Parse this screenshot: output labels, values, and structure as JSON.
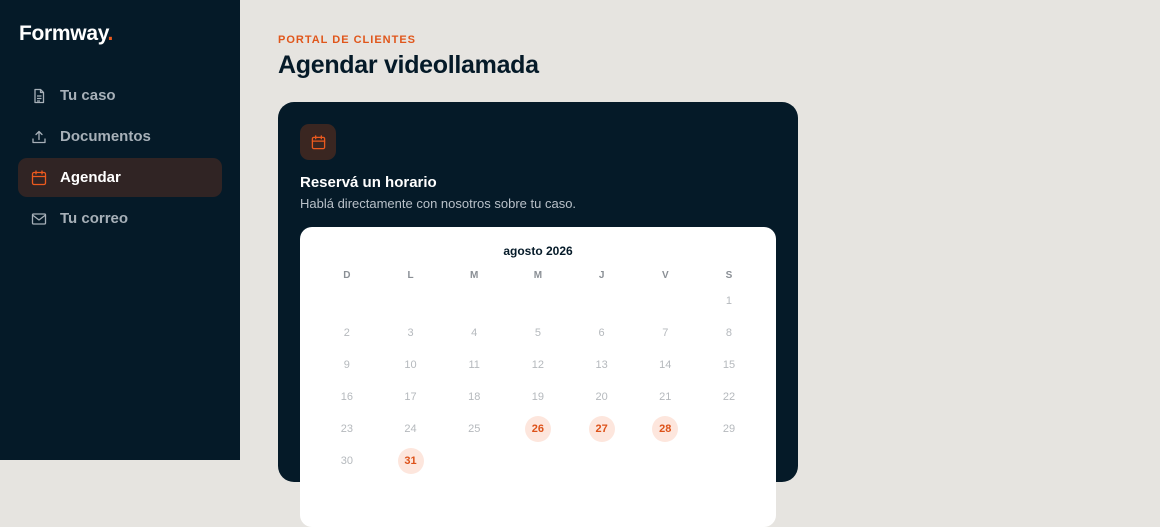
{
  "brand": {
    "name": "Formway",
    "dot": "."
  },
  "sidebar": {
    "items": [
      {
        "label": "Tu caso",
        "icon": "file-icon",
        "active": false
      },
      {
        "label": "Documentos",
        "icon": "upload-icon",
        "active": false
      },
      {
        "label": "Agendar",
        "icon": "calendar-icon",
        "active": true
      },
      {
        "label": "Tu correo",
        "icon": "mail-icon",
        "active": false
      }
    ]
  },
  "header": {
    "eyebrow": "PORTAL DE CLIENTES",
    "title": "Agendar videollamada"
  },
  "card": {
    "icon": "calendar-icon",
    "title": "Reservá un horario",
    "subtitle": "Hablá directamente con nosotros sobre tu caso."
  },
  "calendar": {
    "month": "agosto 2026",
    "weekdays": [
      "D",
      "L",
      "M",
      "M",
      "J",
      "V",
      "S"
    ],
    "weeks": [
      [
        "",
        "",
        "",
        "",
        "",
        "",
        "1"
      ],
      [
        "2",
        "3",
        "4",
        "5",
        "6",
        "7",
        "8"
      ],
      [
        "9",
        "10",
        "11",
        "12",
        "13",
        "14",
        "15"
      ],
      [
        "16",
        "17",
        "18",
        "19",
        "20",
        "21",
        "22"
      ],
      [
        "23",
        "24",
        "25",
        "26",
        "27",
        "28",
        "29"
      ],
      [
        "30",
        "31",
        "",
        "",
        "",
        "",
        ""
      ]
    ],
    "available_days": [
      "26",
      "27",
      "28",
      "31"
    ]
  },
  "colors": {
    "sidebar_bg": "#051a28",
    "accent": "#ec5a1e",
    "page_bg": "#e6e4e0",
    "available_bg": "#fde6dd"
  }
}
